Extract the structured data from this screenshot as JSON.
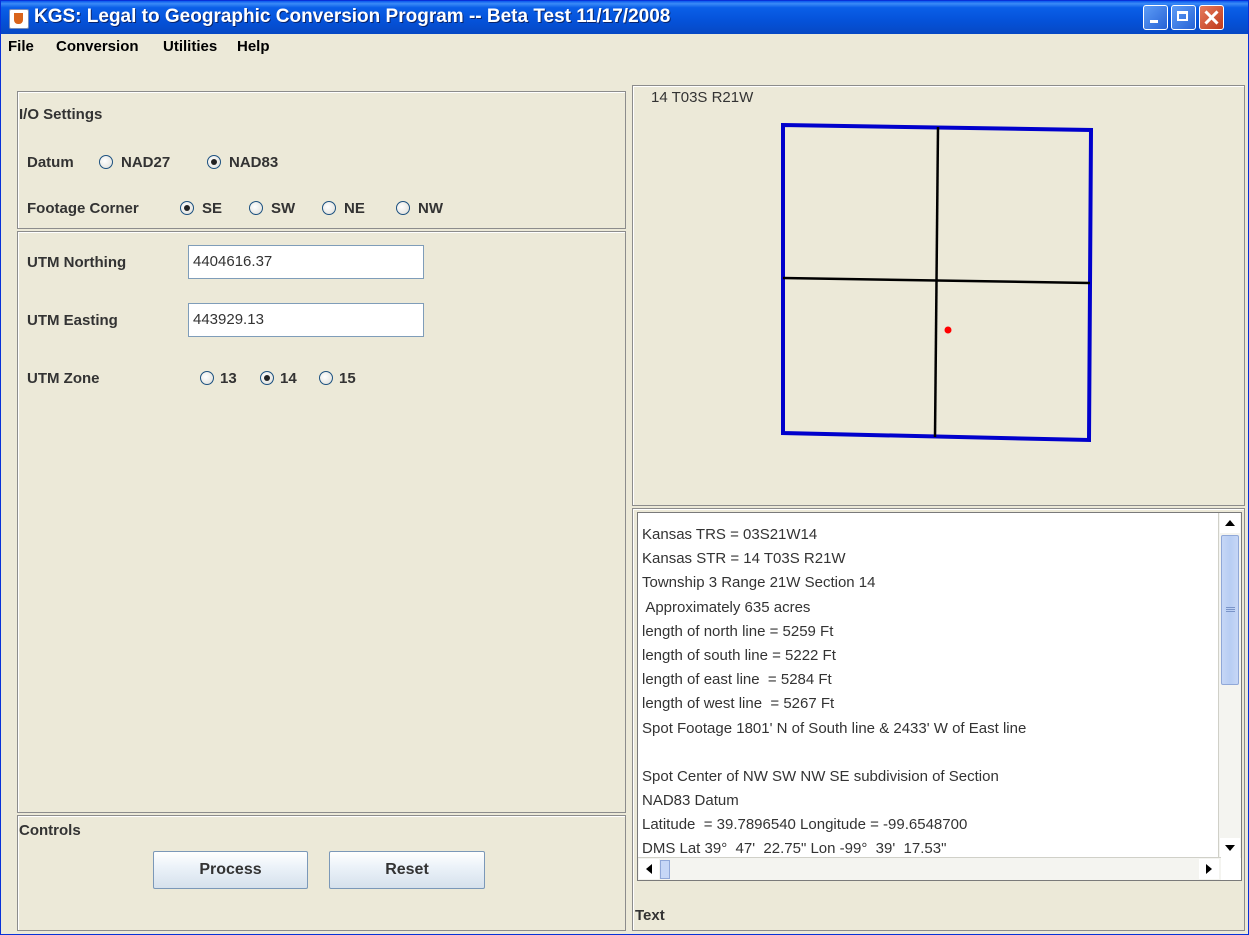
{
  "window": {
    "title": "KGS: Legal to Geographic Conversion Program -- Beta Test 11/17/2008"
  },
  "menu": [
    "File",
    "Conversion",
    "Utilities",
    "Help"
  ],
  "io_settings": {
    "heading": "I/O Settings",
    "datum_label": "Datum",
    "datum_options": [
      {
        "label": "NAD27",
        "selected": false
      },
      {
        "label": "NAD83",
        "selected": true
      }
    ],
    "footage_label": "Footage Corner",
    "footage_options": [
      {
        "label": "SE",
        "selected": true
      },
      {
        "label": "SW",
        "selected": false
      },
      {
        "label": "NE",
        "selected": false
      },
      {
        "label": "NW",
        "selected": false
      }
    ]
  },
  "utm": {
    "northing_label": "UTM Northing",
    "northing_value": "4404616.37",
    "easting_label": "UTM Easting",
    "easting_value": "443929.13",
    "zone_label": "UTM Zone",
    "zone_options": [
      {
        "label": "13",
        "selected": false
      },
      {
        "label": "14",
        "selected": true
      },
      {
        "label": "15",
        "selected": false
      }
    ]
  },
  "controls": {
    "heading": "Controls",
    "process_label": "Process",
    "reset_label": "Reset"
  },
  "map": {
    "section_label": "14 T03S R21W",
    "boundary_color": "#0000cc",
    "subdivision_color": "#000000",
    "spot_color": "#ff0000"
  },
  "output": {
    "footer_label": "Text",
    "lines": [
      "Kansas TRS = 03S21W14",
      "Kansas STR = 14 T03S R21W",
      "Township 3 Range 21W Section 14",
      " Approximately 635 acres",
      "length of north line = 5259 Ft",
      "length of south line = 5222 Ft",
      "length of east line  = 5284 Ft",
      "length of west line  = 5267 Ft",
      "Spot Footage 1801' N of South line & 2433' W of East line",
      "",
      "Spot Center of NW SW NW SE subdivision of Section",
      "NAD83 Datum",
      "Latitude  = 39.7896540 Longitude = -99.6548700",
      "DMS Lat 39°  47'  22.75\" Lon -99°  39'  17.53\""
    ]
  }
}
